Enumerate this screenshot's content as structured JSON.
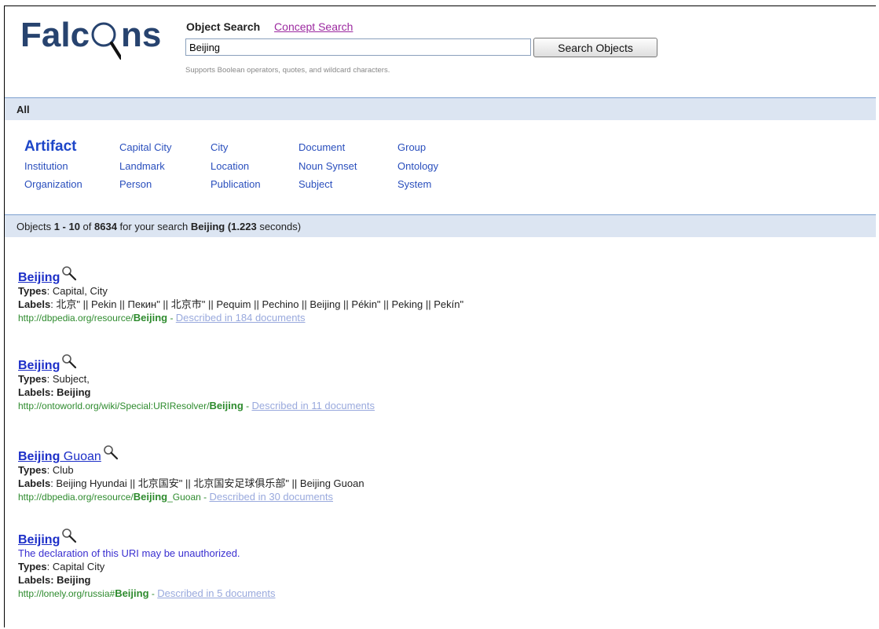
{
  "logo": {
    "text_before": "Falc",
    "text_after": "ns"
  },
  "search": {
    "tab_active": "Object Search",
    "tab_other": "Concept Search",
    "value": "Beijing",
    "button": "Search Objects",
    "hint": "Supports Boolean operators, quotes, and wildcard characters."
  },
  "filter_bar": {
    "label": "All"
  },
  "categories": {
    "row1": [
      "Artifact",
      "Capital City",
      "City",
      "Document",
      "Group"
    ],
    "row2": [
      "Institution",
      "Landmark",
      "Location",
      "Noun Synset",
      "Ontology"
    ],
    "row3": [
      "Organization",
      "Person",
      "Publication",
      "Subject",
      "System"
    ]
  },
  "status": {
    "prefix": "Objects ",
    "range": "1 - 10",
    "of": " of ",
    "total": "8634",
    "mid": " for your search ",
    "query": "Beijing",
    "time": "(1.223",
    "suffix": " seconds)"
  },
  "results": [
    {
      "title_bold": "Beijing",
      "title_rest": "",
      "warning": "",
      "types_label": "Types",
      "types": ": Capital, City",
      "labels_label": "Labels",
      "labels": ": 北京\" || Pekin || Пекин\" || 北京市\" || Pequim || Pechino || Beijing || Pékin\" || Peking || Pekín\"",
      "url_prefix": "http://dbpedia.org/resource/",
      "url_bold": "Beijing",
      "url_suffix": "",
      "described": "Described in 184 documents"
    },
    {
      "title_bold": "Beijing",
      "title_rest": "",
      "warning": "",
      "types_label": "Types",
      "types": ": Subject,",
      "labels_label": "Labels",
      "labels": ": Beijing",
      "url_prefix": "http://ontoworld.org/wiki/Special:URIResolver/",
      "url_bold": "Beijing",
      "url_suffix": "",
      "described": "Described in 11 documents"
    },
    {
      "title_bold": "Beijing",
      "title_rest": " Guoan",
      "warning": "",
      "types_label": "Types",
      "types": ": Club",
      "labels_label": "Labels",
      "labels": ": Beijing Hyundai || 北京国安\" || 北京国安足球俱乐部\" || Beijing Guoan",
      "url_prefix": "http://dbpedia.org/resource/",
      "url_bold": "Beijing",
      "url_suffix": "_Guoan",
      "described": "Described in 30 documents"
    },
    {
      "title_bold": "Beijing",
      "title_rest": "",
      "warning": "The declaration of this URI may be unauthorized.",
      "types_label": "Types",
      "types": ": Capital City",
      "labels_label": "Labels",
      "labels": ": Beijing",
      "url_prefix": "http://lonely.org/russia#",
      "url_bold": "Beijing",
      "url_suffix": "",
      "described": "Described in 5 documents"
    }
  ],
  "url_separator": " - "
}
